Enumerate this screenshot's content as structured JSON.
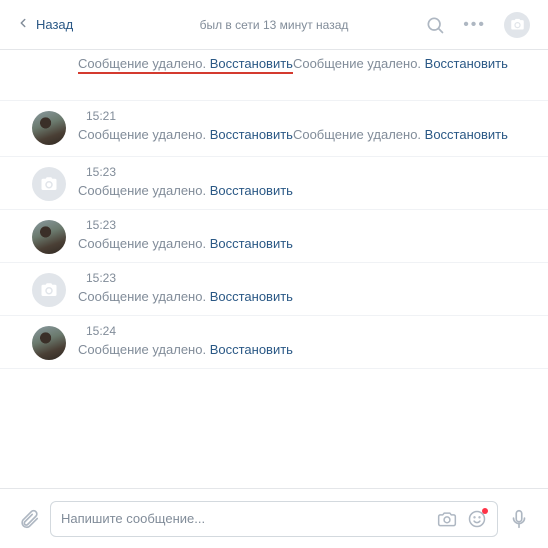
{
  "header": {
    "back_label": "Назад",
    "status": "был в сети 13 минут назад"
  },
  "deleted_text": "Сообщение удалено.",
  "restore_text": "Восстановить",
  "groups": [
    {
      "avatar": "none",
      "time": "",
      "lines": 2,
      "underline_first": true
    },
    {
      "avatar": "photo",
      "time": "15:21",
      "lines": 2
    },
    {
      "avatar": "cam",
      "time": "15:23",
      "lines": 1
    },
    {
      "avatar": "photo",
      "time": "15:23",
      "lines": 1
    },
    {
      "avatar": "cam",
      "time": "15:23",
      "lines": 1
    },
    {
      "avatar": "photo",
      "time": "15:24",
      "lines": 1
    }
  ],
  "composer": {
    "placeholder": "Напишите сообщение..."
  }
}
